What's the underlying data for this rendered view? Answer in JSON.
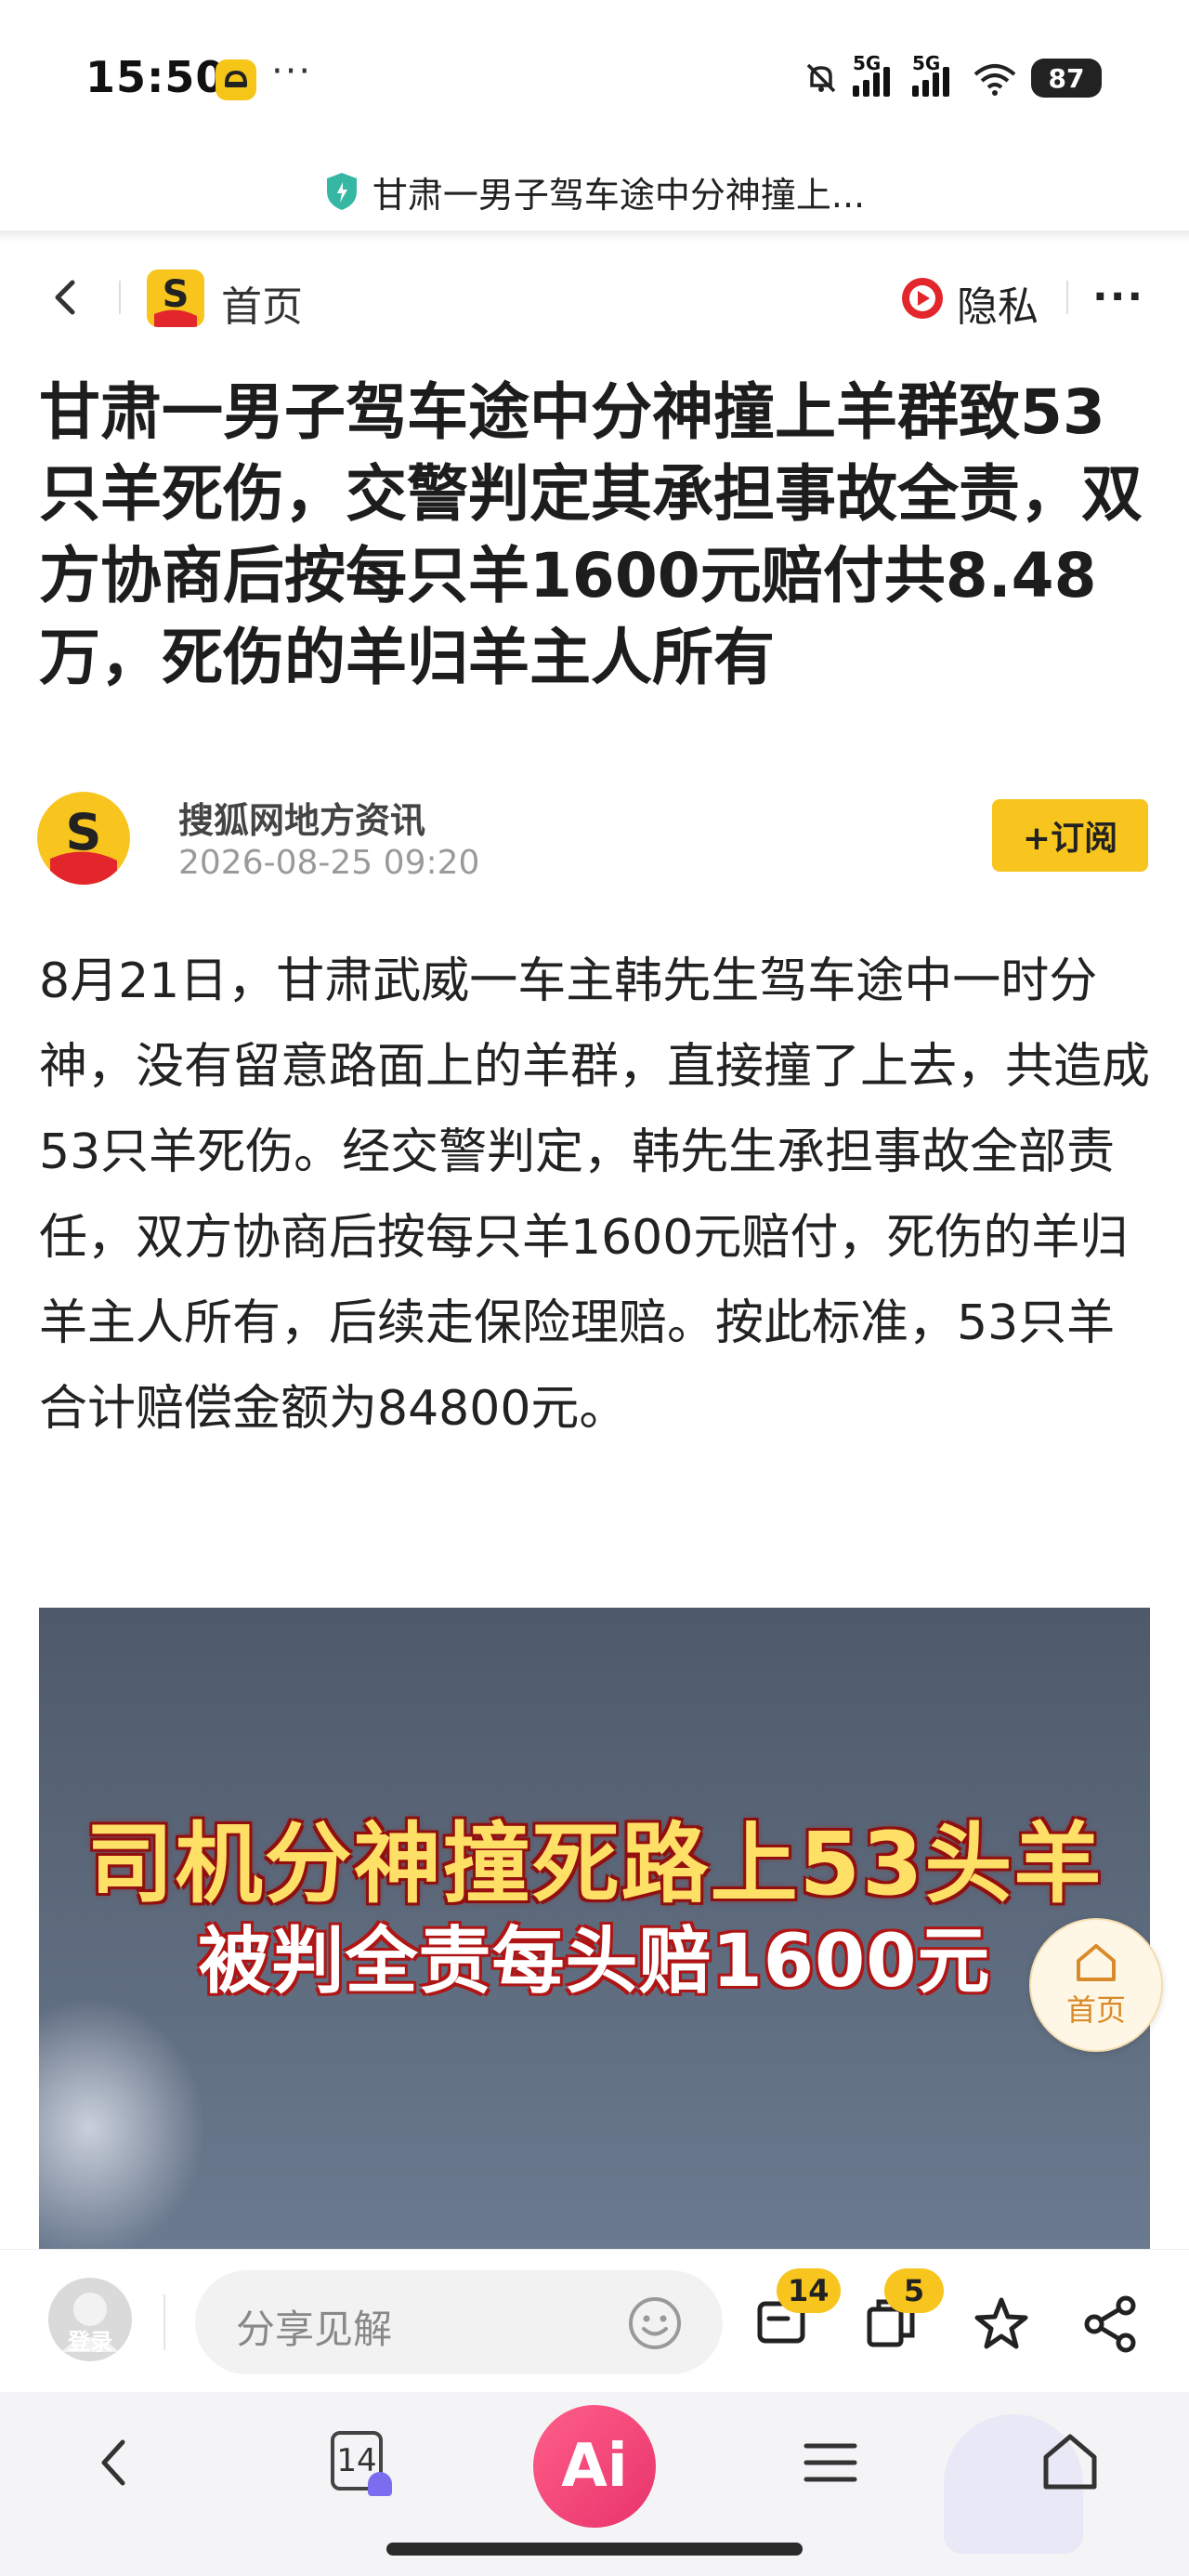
{
  "status_bar": {
    "time": "15:50",
    "more": "···",
    "signal_1": "5G",
    "signal_2": "5G",
    "battery": "87"
  },
  "url_bar": {
    "title": "甘肃一男子驾车途中分神撞上..."
  },
  "nav": {
    "home_label": "首页",
    "privacy_label": "隐私",
    "more": "···"
  },
  "article": {
    "headline": "甘肃一男子驾车途中分神撞上羊群致53只羊死伤，交警判定其承担事故全责，双方协商后按每只羊1600元赔付共8.48万，死伤的羊归羊主人所有",
    "author": "搜狐网地方资讯",
    "date": "2026-08-25 09:20",
    "subscribe_label": "+订阅",
    "body": "8月21日，甘肃武威一车主韩先生驾车途中一时分神，没有留意路面上的羊群，直接撞了上去，共造成53只羊死伤。经交警判定，韩先生承担事故全部责任，双方协商后按每只羊1600元赔付，死伤的羊归羊主人所有，后续走保险理赔。按此标准，53只羊合计赔偿金额为84800元。",
    "image_caption_1": "司机分神撞死路上53头羊",
    "image_caption_2": "被判全责每头赔1600元"
  },
  "float_home": {
    "label": "首页"
  },
  "comment_bar": {
    "login_label": "登录",
    "placeholder": "分享见解",
    "comments_count": "14",
    "collections_count": "5"
  },
  "bottom_nav": {
    "tabs_count": "14",
    "ai_label": "Ai"
  },
  "colors": {
    "brand_yellow": "#f7c51e",
    "ai_pink": "#e8336b",
    "privacy_red": "#e3262b"
  }
}
